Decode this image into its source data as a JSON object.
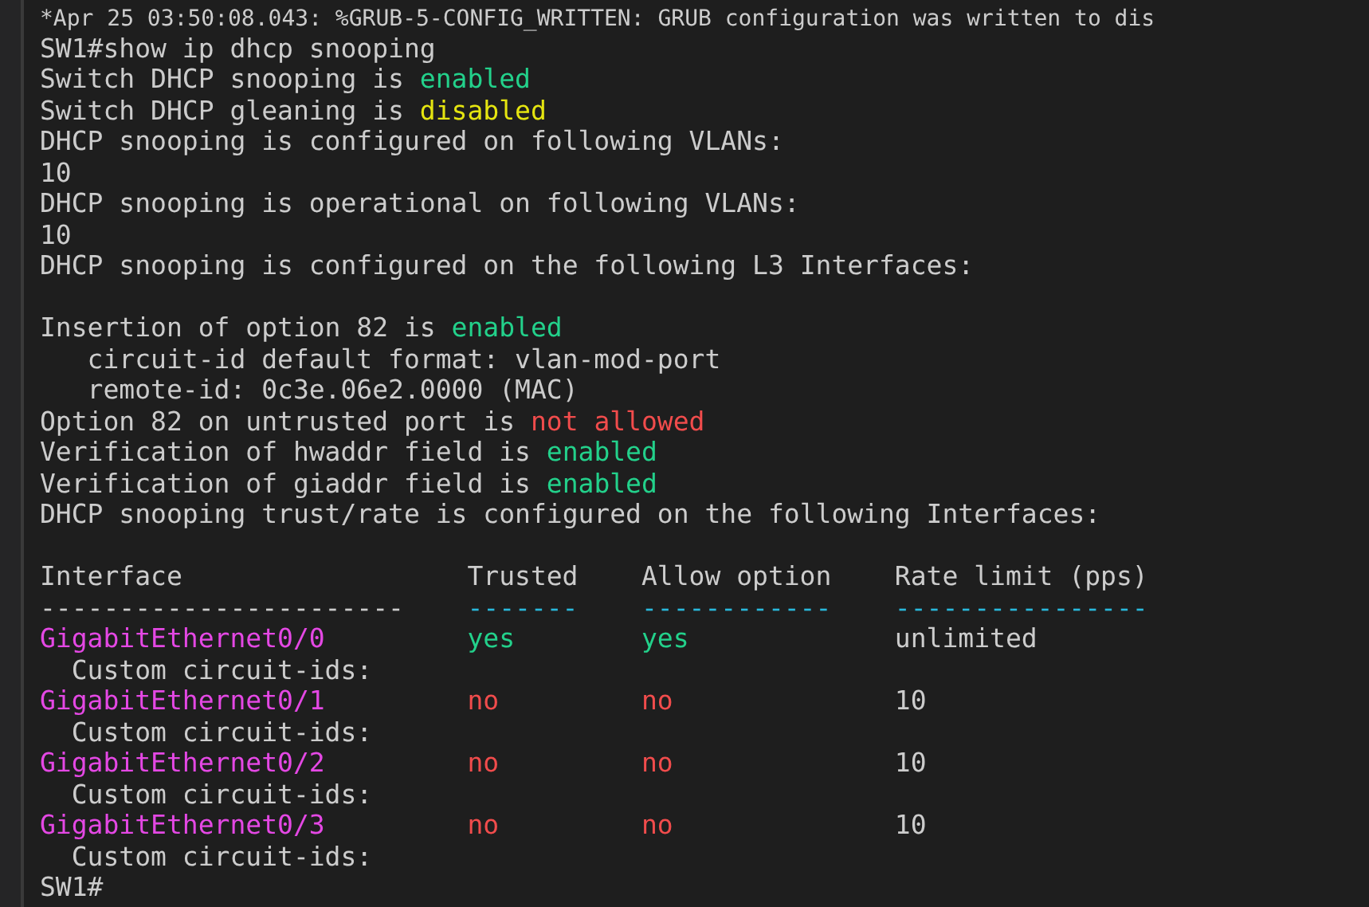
{
  "terminal": {
    "lines": [
      {
        "kind": "log",
        "segments": [
          {
            "text": "*Apr 25 03:50:08.043: %GRUB-5-CONFIG_WRITTEN: GRUB configuration was written to dis"
          }
        ]
      },
      {
        "kind": "text",
        "segments": [
          {
            "text": "SW1#show ip dhcp snooping"
          }
        ]
      },
      {
        "kind": "text",
        "segments": [
          {
            "text": "Switch DHCP snooping is "
          },
          {
            "text": "enabled",
            "color": "#23d18b"
          }
        ]
      },
      {
        "kind": "text",
        "segments": [
          {
            "text": "Switch DHCP gleaning is "
          },
          {
            "text": "disabled",
            "color": "#e5e510"
          }
        ]
      },
      {
        "kind": "text",
        "segments": [
          {
            "text": "DHCP snooping is configured on following VLANs:"
          }
        ]
      },
      {
        "kind": "text",
        "segments": [
          {
            "text": "10"
          }
        ]
      },
      {
        "kind": "text",
        "segments": [
          {
            "text": "DHCP snooping is operational on following VLANs:"
          }
        ]
      },
      {
        "kind": "text",
        "segments": [
          {
            "text": "10"
          }
        ]
      },
      {
        "kind": "text",
        "segments": [
          {
            "text": "DHCP snooping is configured on the following L3 Interfaces:"
          }
        ]
      },
      {
        "kind": "blank"
      },
      {
        "kind": "text",
        "segments": [
          {
            "text": "Insertion of option 82 is "
          },
          {
            "text": "enabled",
            "color": "#23d18b"
          }
        ]
      },
      {
        "kind": "text",
        "segments": [
          {
            "text": "   circuit-id default format: vlan-mod-port"
          }
        ]
      },
      {
        "kind": "text",
        "segments": [
          {
            "text": "   remote-id: 0c3e.06e2.0000 (MAC)"
          }
        ]
      },
      {
        "kind": "text",
        "segments": [
          {
            "text": "Option 82 on untrusted port is "
          },
          {
            "text": "not allowed",
            "color": "#f14c4c"
          }
        ]
      },
      {
        "kind": "text",
        "segments": [
          {
            "text": "Verification of hwaddr field is "
          },
          {
            "text": "enabled",
            "color": "#23d18b"
          }
        ]
      },
      {
        "kind": "text",
        "segments": [
          {
            "text": "Verification of giaddr field is "
          },
          {
            "text": "enabled",
            "color": "#23d18b"
          }
        ]
      },
      {
        "kind": "text",
        "segments": [
          {
            "text": "DHCP snooping trust/rate is configured on the following Interfaces:"
          }
        ]
      },
      {
        "kind": "blank"
      }
    ],
    "table": {
      "columns": [
        {
          "label": "Interface",
          "rule": "-----------------------",
          "color": "#cccccc"
        },
        {
          "label": "Trusted",
          "rule": "-------",
          "color": "#29b8db"
        },
        {
          "label": "Allow option",
          "rule": "------------",
          "color": "#29b8db"
        },
        {
          "label": "Rate limit (pps)",
          "rule": "----------------",
          "color": "#29b8db"
        }
      ],
      "rows": [
        {
          "cells": [
            {
              "text": "GigabitEthernet0/0",
              "color": "#e448e4"
            },
            {
              "text": "yes",
              "color": "#23d18b"
            },
            {
              "text": "yes",
              "color": "#23d18b"
            },
            {
              "text": "unlimited",
              "color": "#cccccc"
            }
          ],
          "note": "  Custom circuit-ids:"
        },
        {
          "cells": [
            {
              "text": "GigabitEthernet0/1",
              "color": "#e448e4"
            },
            {
              "text": "no",
              "color": "#f14c4c"
            },
            {
              "text": "no",
              "color": "#f14c4c"
            },
            {
              "text": "10",
              "color": "#cccccc"
            }
          ],
          "note": "  Custom circuit-ids:"
        },
        {
          "cells": [
            {
              "text": "GigabitEthernet0/2",
              "color": "#e448e4"
            },
            {
              "text": "no",
              "color": "#f14c4c"
            },
            {
              "text": "no",
              "color": "#f14c4c"
            },
            {
              "text": "10",
              "color": "#cccccc"
            }
          ],
          "note": "  Custom circuit-ids:"
        },
        {
          "cells": [
            {
              "text": "GigabitEthernet0/3",
              "color": "#e448e4"
            },
            {
              "text": "no",
              "color": "#f14c4c"
            },
            {
              "text": "no",
              "color": "#f14c4c"
            },
            {
              "text": "10",
              "color": "#cccccc"
            }
          ],
          "note": "  Custom circuit-ids:"
        }
      ]
    },
    "prompt": "SW1#"
  }
}
